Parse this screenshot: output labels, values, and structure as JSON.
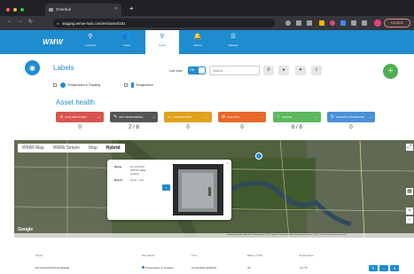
{
  "browser": {
    "tab_title": "Overdue",
    "new_tab": "+",
    "tab_close": "×",
    "url": "staging.wmw-hub.com/en/asset/181",
    "update_label": "Update",
    "back": "←",
    "forward": "→",
    "reload": "↻",
    "lock": "🔒"
  },
  "app": {
    "logo": "WMW",
    "nav": [
      {
        "label": "Locations",
        "icon": "⚲"
      },
      {
        "label": "Users",
        "icon": "👥"
      },
      {
        "label": "Assets",
        "icon": "⚲"
      },
      {
        "label": "Alarms",
        "icon": "🔔"
      },
      {
        "label": "Settings",
        "icon": "☰"
      }
    ]
  },
  "labels": {
    "title": "Labels",
    "items": [
      {
        "label": "Temperature & Tracking"
      },
      {
        "label": "Temperature"
      }
    ],
    "live_view": "Live view",
    "toggle": "ON",
    "search_placeholder": "Search...",
    "add": "+"
  },
  "asset_health": {
    "title": "Asset health",
    "items": [
      {
        "label": "IN ALARM STATE",
        "count": "0",
        "color": "#d9534f",
        "icon": "⚠"
      },
      {
        "label": "NOT RESPONDING",
        "count": "2 / 8",
        "color": "#555555",
        "icon": "✎"
      },
      {
        "label": "LOW BATTERY",
        "count": "0",
        "color": "#e0a21b",
        "icon": "▭"
      },
      {
        "label": "INACTIVE",
        "count": "0",
        "color": "#e8692a",
        "icon": "⊘"
      },
      {
        "label": "ACTIVE",
        "count": "6 / 8",
        "color": "#5cb85c",
        "icon": "✓"
      },
      {
        "label": "ALWAYS CONNECTED",
        "count": "0",
        "color": "#4a90d9",
        "icon": "↻"
      }
    ]
  },
  "map": {
    "tabs": [
      "WMW Map",
      "WMW Simple",
      "Map",
      "Hybrid"
    ],
    "active_tab": "Hybrid",
    "popup": {
      "name_key": "Name",
      "name_val": "WY-015 (IM 005715 (Bag Cooler)",
      "brand_key": "Brand",
      "brand_val": "None - Tag",
      "close": "×",
      "go": "+"
    },
    "zoom_in": "+",
    "zoom_out": "−",
    "fullscreen": "⤢",
    "google": "Google",
    "footer": "Keyboard shortcuts | Map data ©2024 Imagery ©2024 , Landsat / Copernicus, Maxar Technologies, Map data ©2024 | Terms of Use | Report a map error"
  },
  "table": {
    "headers": [
      "Name",
      "Set Labels",
      "Time",
      "Battery (Volt)",
      "Temperature"
    ],
    "row": {
      "name": "WY-015 (IM 005715 (Mobile)",
      "label": "Temperature & Tracking",
      "time": "21-03-2023 09:58:36",
      "battery": "3V",
      "temperature": "-71.7°F"
    }
  }
}
